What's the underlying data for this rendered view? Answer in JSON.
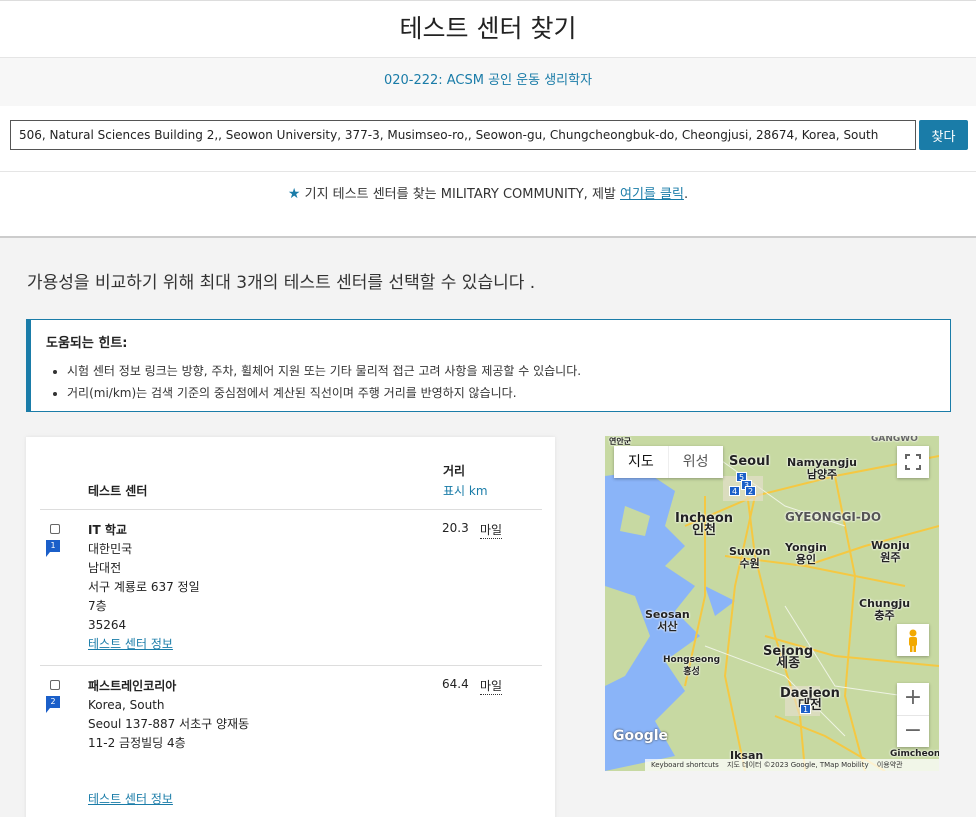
{
  "header": {
    "title": "테스트 센터 찾기"
  },
  "exam": {
    "label": "020-222: ACSM 공인 운동 생리학자"
  },
  "search": {
    "value": "506, Natural Sciences Building 2,, Seowon University, 377-3, Musimseo-ro,, Seowon-gu, Chungcheongbuk-do, Cheongjusi, 28674, Korea, South",
    "button": "찾다"
  },
  "military": {
    "text": "기지 테스트 센터를 찾는 MILITARY COMMUNITY, 제발 ",
    "link": "여기를 클릭",
    "suffix": "."
  },
  "intro": "가용성을 비교하기 위해 최대 3개의 테스트 센터를 선택할 수 있습니다 .",
  "tips": {
    "title": "도움되는 힌트:",
    "items": [
      "시험 센터 정보 링크는 방향, 주차, 휠체어 지원 또는 기타 물리적 접근 고려 사항을 제공할 수 있습니다.",
      "거리(mi/km)는 검색 기준의 중심점에서 계산된 직선이며 주행 거리를 반영하지 않습니다."
    ]
  },
  "table": {
    "col_center": "테스트 센터",
    "col_distance": "거리",
    "unit_toggle": "표시 km",
    "rows": [
      {
        "marker": "1",
        "name": "IT 학교",
        "lines": [
          "대한민국",
          "남대전",
          "서구 계룡로 637 정일",
          "7층",
          "35264"
        ],
        "distance": "20.3",
        "unit": "마일",
        "info_link": "테스트 센터 정보"
      },
      {
        "marker": "2",
        "name": "패스트레인코리아",
        "lines": [
          "Korea, South",
          "Seoul 137-887 서초구 양재동",
          "11-2 금정빌딩 4층"
        ],
        "distance": "64.4",
        "unit": "마일",
        "info_link": "테스트 센터 정보"
      }
    ]
  },
  "map": {
    "type_map": "지도",
    "type_satellite": "위성",
    "logo": "Google",
    "attribution": [
      "Keyboard shortcuts",
      "지도 데이터 ©2023 Google, TMap Mobility",
      "이용약관"
    ],
    "zoom_in": "+",
    "zoom_out": "−",
    "labels": {
      "seoul": "Seoul",
      "namyangju": "Namyangju\n남양주",
      "incheon": "Incheon\n인천",
      "gyeonggi": "GYEONGGI-DO",
      "suwon": "Suwon\n수원",
      "yongin": "Yongin\n용인",
      "wonju": "Wonju\n원주",
      "seosan": "Seosan\n서산",
      "chungju": "Chungju\n충주",
      "hongseong": "Hongseong\n홍성",
      "sejong": "Sejong\n세종",
      "daejeon": "Daejeon\n대전",
      "iksan": "Iksan",
      "gimcheon": "Gimcheon",
      "gangwon": "GANGWO",
      "yeonan": "연안군"
    },
    "markers": [
      "5",
      "3",
      "4",
      "2",
      "1"
    ],
    "colors": {
      "land": "#c7d9a2",
      "sea": "#8ab4f8",
      "road": "#f5c842",
      "city": "#e8e0d0"
    }
  }
}
